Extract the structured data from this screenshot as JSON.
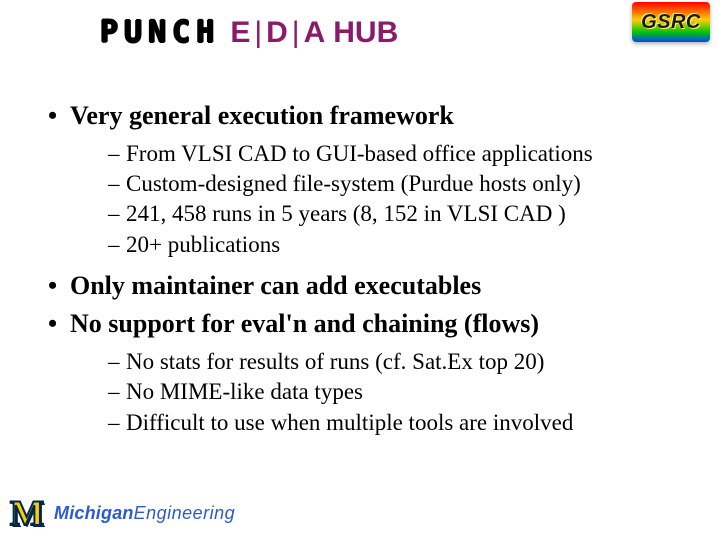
{
  "header": {
    "punch": "PUNCH",
    "eda_e": "E",
    "eda_d": "D",
    "eda_a": "A",
    "eda_hub": "HUB",
    "gsrc": "GSRC"
  },
  "bullets": {
    "b1": "Very general execution framework",
    "b1_subs": {
      "s1": "From VLSI CAD to GUI-based office applications",
      "s2": "Custom-designed file-system (Purdue hosts only)",
      "s3": "241, 458 runs in 5 years (8, 152 in VLSI CAD )",
      "s4": "20+ publications"
    },
    "b2": "Only maintainer can add executables",
    "b3": "No support for eval'n and chaining (flows)",
    "b3_subs": {
      "s1": "No stats for results of runs (cf. Sat.Ex top 20)",
      "s2": "No MIME-like data types",
      "s3": "Difficult to use when multiple tools are involved"
    }
  },
  "footer": {
    "m": "M",
    "mich": "Michigan",
    "eng": "Engineering"
  }
}
